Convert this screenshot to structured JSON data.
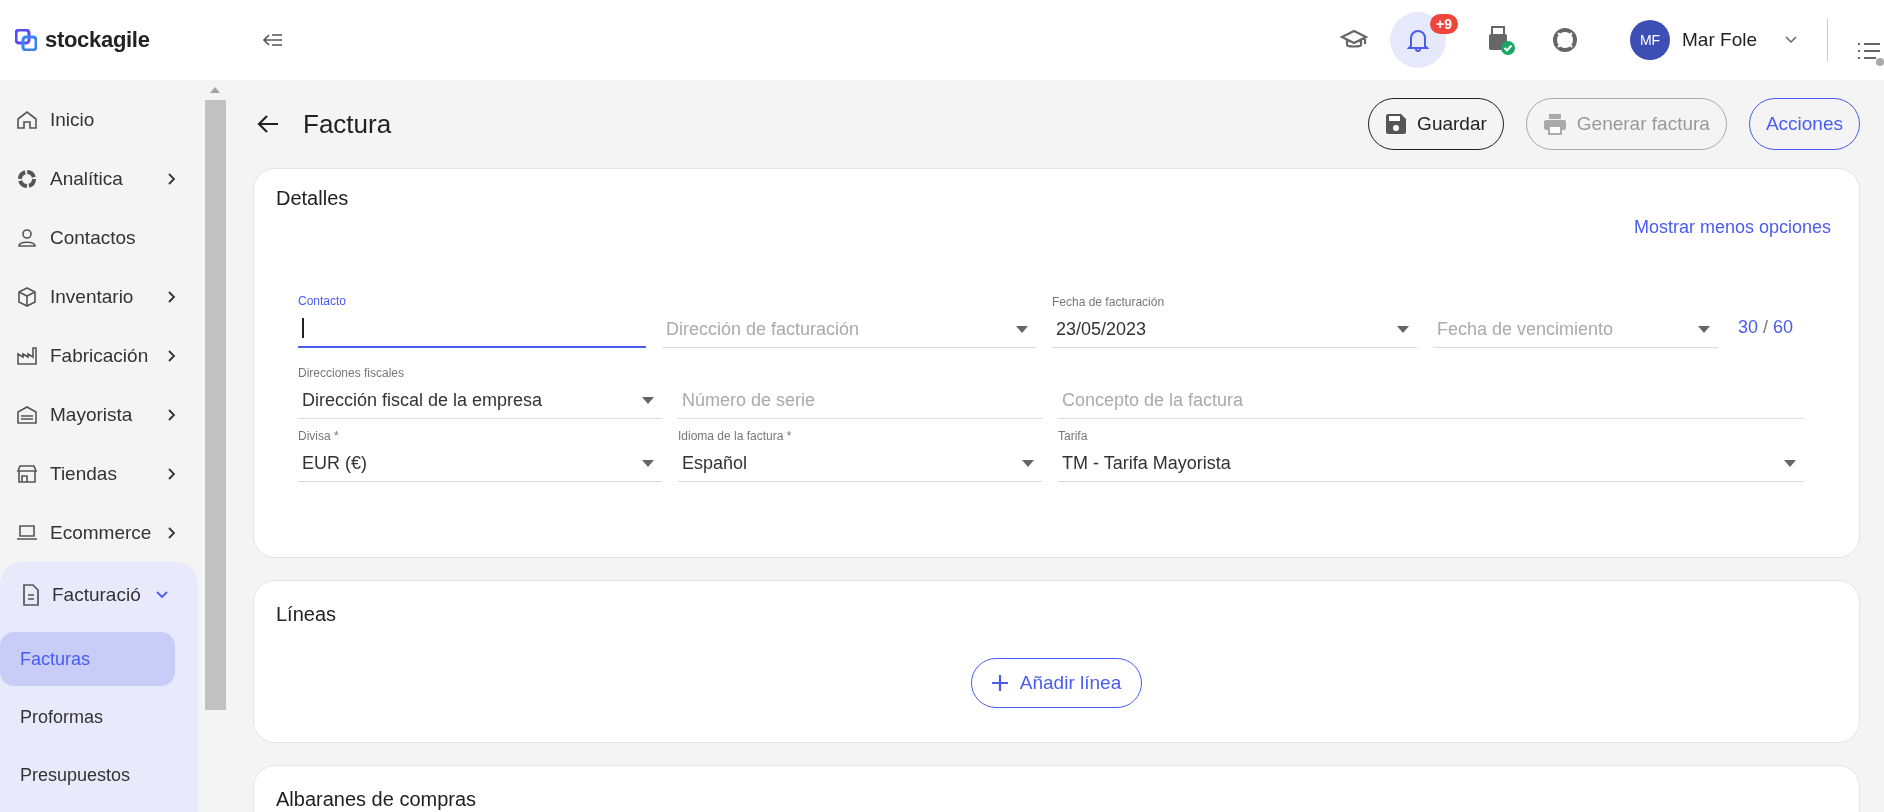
{
  "header": {
    "logo": "stockagile",
    "notifications": {
      "badge": "+9",
      "selected": true
    },
    "printer_connected": true,
    "user": {
      "initials": "MF",
      "name": "Mar Fole"
    }
  },
  "sidebar": {
    "items": [
      {
        "label": "Inicio",
        "kind": "link"
      },
      {
        "label": "Analítica",
        "kind": "group",
        "expanded": false
      },
      {
        "label": "Contactos",
        "kind": "link"
      },
      {
        "label": "Inventario",
        "kind": "group",
        "expanded": false
      },
      {
        "label": "Fabricación",
        "kind": "group",
        "expanded": false
      },
      {
        "label": "Mayorista",
        "kind": "group",
        "expanded": false
      },
      {
        "label": "Tiendas",
        "kind": "group",
        "expanded": false
      },
      {
        "label": "Ecommerce",
        "kind": "group",
        "expanded": false
      },
      {
        "label": "Facturació",
        "kind": "group",
        "expanded": true,
        "children": [
          {
            "label": "Facturas",
            "selected": true
          },
          {
            "label": "Proformas",
            "selected": false
          },
          {
            "label": "Presupuestos",
            "selected": false
          }
        ]
      }
    ]
  },
  "page": {
    "title": "Factura",
    "buttons": [
      {
        "label": "Guardar",
        "kind": "save",
        "disabled": false
      },
      {
        "label": "Generar factura",
        "kind": "print",
        "disabled": true
      },
      {
        "label": "Acciones",
        "kind": "menu",
        "disabled": false
      }
    ]
  },
  "details": {
    "title": "Detalles",
    "toggle_link": "Mostrar menos opciones",
    "rows": [
      [
        {
          "kind": "text",
          "label": "Contacto",
          "focused": true
        },
        {
          "kind": "select",
          "placeholder": "Dirección de facturación",
          "focused": false
        },
        {
          "kind": "select",
          "label": "Fecha de facturación",
          "value": "23/05/2023",
          "focused": false
        },
        {
          "kind": "select",
          "placeholder": "Fecha de vencimiento",
          "focused": false
        }
      ],
      [
        {
          "kind": "select",
          "label": "Direcciones fiscales",
          "value": "Dirección fiscal de la empresa",
          "focused": false
        },
        {
          "kind": "text",
          "placeholder": "Número de serie",
          "focused": false
        },
        {
          "kind": "text",
          "placeholder": "Concepto de la factura",
          "focused": false
        }
      ],
      [
        {
          "kind": "select",
          "label": "Divisa *",
          "value": "EUR (€)",
          "focused": false
        },
        {
          "kind": "select",
          "label": "Idioma de la factura *",
          "value": "Español",
          "focused": false
        },
        {
          "kind": "select",
          "label": "Tarifa",
          "value": "TM - Tarifa Mayorista",
          "focused": false
        }
      ]
    ],
    "due_shortcuts": [
      "30",
      "60"
    ],
    "due_separator": "/"
  },
  "lines": {
    "title": "Líneas",
    "add_button": "Añadir línea"
  },
  "purchase_notes": {
    "title": "Albaranes de compras"
  }
}
